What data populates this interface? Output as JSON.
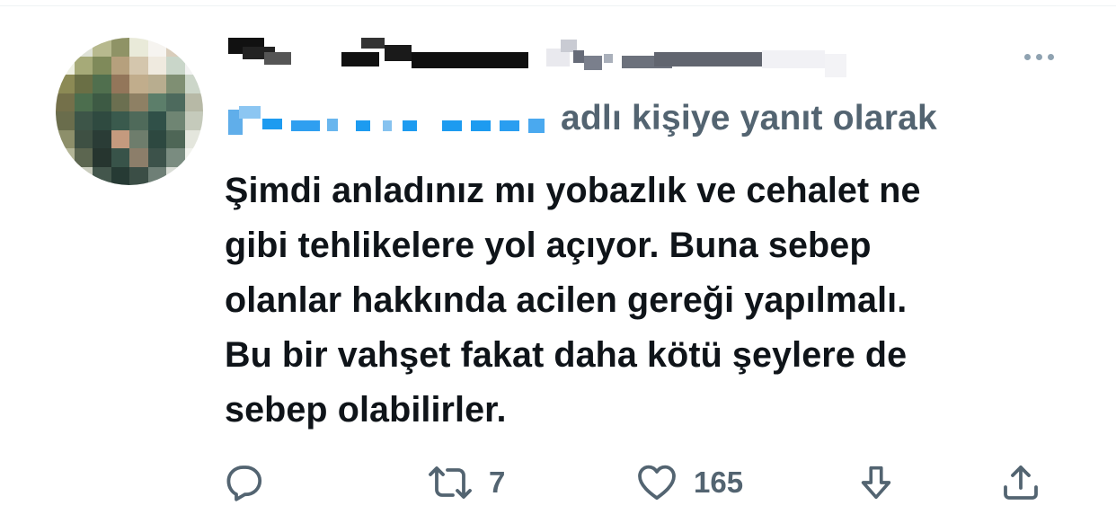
{
  "tweet": {
    "reply_context_suffix": "adlı kişiye yanıt olarak",
    "text_lines": [
      "Şimdi anladınız mı yobazlık ve cehalet ne",
      "gibi tehlikelere yol açıyor. Buna sebep",
      "olanlar hakkında acilen gereği yapılmalı.",
      "Bu bir vahşet fakat daha kötü şeylere de",
      "sebep olabilirler."
    ],
    "retweet_count": "7",
    "like_count": "165"
  },
  "icons": {
    "more": "more-horizontal-icon",
    "reply": "reply-bubble-icon",
    "retweet": "retweet-icon",
    "like": "heart-icon",
    "downvote": "downvote-arrow-icon",
    "share": "share-icon"
  },
  "colors": {
    "text_primary": "#0f1419",
    "text_secondary": "#536471",
    "handle_blue": "#1d9bf0",
    "icon_muted": "#8fa2b1"
  }
}
